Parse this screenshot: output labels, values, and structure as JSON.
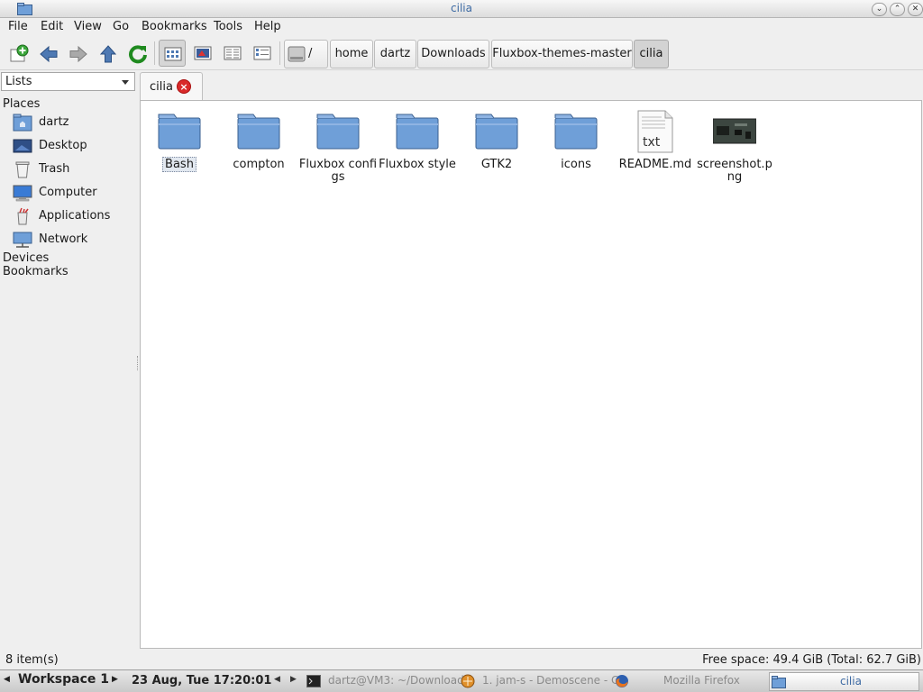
{
  "window": {
    "title": "cilia",
    "buttons": [
      "⌄",
      "⌃",
      "✕"
    ]
  },
  "menu": [
    {
      "label": "File"
    },
    {
      "label": "Edit"
    },
    {
      "label": "View"
    },
    {
      "label": "Go"
    },
    {
      "label": "Bookmarks"
    },
    {
      "label": "Tools"
    },
    {
      "label": "Help"
    }
  ],
  "toolbar": {
    "tools": [
      "new-tab-icon",
      "back-icon",
      "forward-icon",
      "up-icon",
      "reload-icon",
      "icon-view-icon",
      "thumbnail-view-icon",
      "compact-view-icon",
      "detailed-list-view-icon"
    ],
    "path": {
      "root_label": "/",
      "crumbs": [
        "home",
        "dartz",
        "Downloads",
        "Fluxbox-themes-master",
        "cilia"
      ]
    }
  },
  "side": {
    "mode": "Lists",
    "headings": {
      "places": "Places",
      "devices": "Devices",
      "bookmarks": "Bookmarks"
    },
    "places": [
      {
        "label": "dartz",
        "icon": "home-folder-icon"
      },
      {
        "label": "Desktop",
        "icon": "desktop-icon"
      },
      {
        "label": "Trash",
        "icon": "trash-icon"
      },
      {
        "label": "Computer",
        "icon": "computer-icon"
      },
      {
        "label": "Applications",
        "icon": "applications-icon"
      },
      {
        "label": "Network",
        "icon": "network-icon"
      }
    ]
  },
  "tab": {
    "label": "cilia"
  },
  "files": [
    {
      "name": "Bash",
      "type": "folder"
    },
    {
      "name": "compton",
      "type": "folder"
    },
    {
      "name": "Fluxbox configs",
      "type": "folder"
    },
    {
      "name": "Fluxbox style",
      "type": "folder"
    },
    {
      "name": "GTK2",
      "type": "folder"
    },
    {
      "name": "icons",
      "type": "folder"
    },
    {
      "name": "README.md",
      "type": "text",
      "badge": "txt"
    },
    {
      "name": "screenshot.png",
      "type": "image"
    }
  ],
  "status": {
    "count": "8 item(s)",
    "free_space": "Free space: 49.4 GiB (Total: 62.7 GiB)"
  },
  "taskbar": {
    "workspace": "Workspace 1",
    "clock": "23 Aug, Tue 17:20:01",
    "tasks": [
      {
        "label": "dartz@VM3: ~/Download",
        "icon": "terminal-icon"
      },
      {
        "label": "1. jam-s - Demoscene - C",
        "icon": "media-player-icon"
      },
      {
        "label": "Mozilla Firefox",
        "icon": "firefox-icon"
      },
      {
        "label": "cilia",
        "icon": "file-manager-icon"
      }
    ]
  },
  "colors": {
    "accent": "#3d6aa3",
    "folder": "#6f9fd8",
    "close_red": "#d92a2a"
  }
}
